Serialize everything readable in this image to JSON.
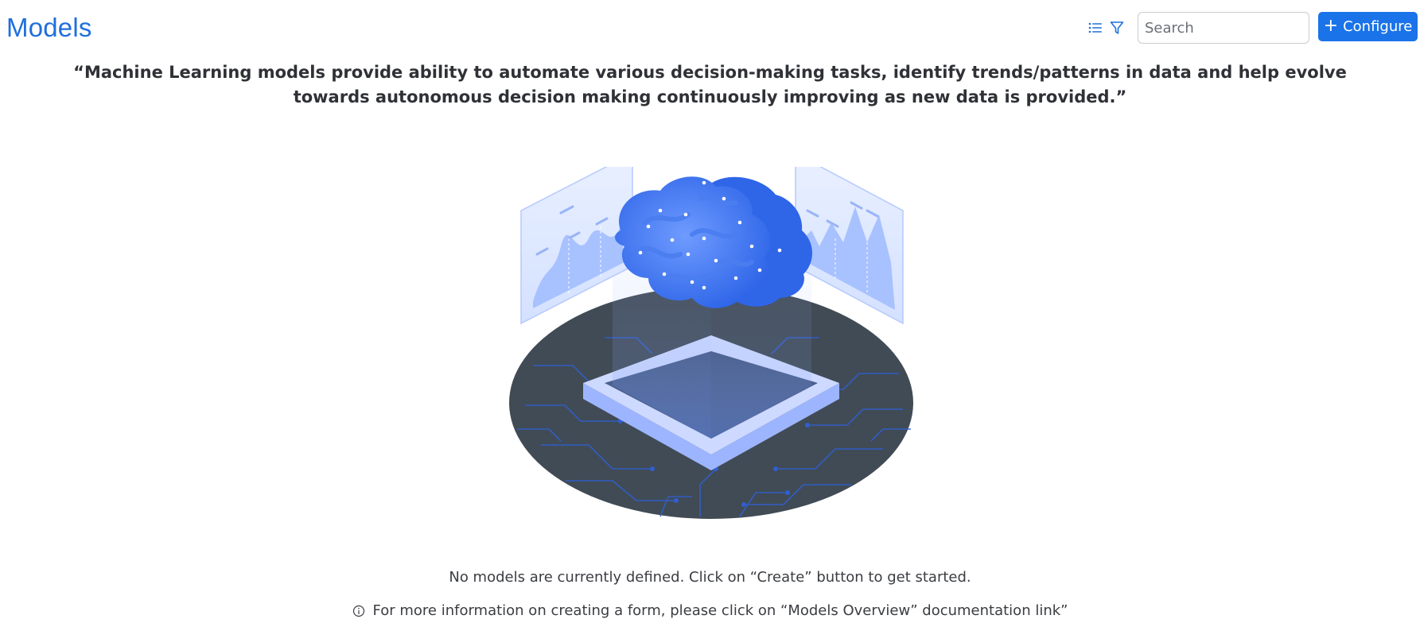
{
  "header": {
    "title": "Models",
    "list_icon": "list-icon",
    "filter_icon": "filter-icon",
    "search": {
      "placeholder": "Search",
      "value": ""
    },
    "configure_label": "Configure"
  },
  "quote": "“Machine Learning models provide ability to automate various decision-making tasks, identify trends/patterns in data and help evolve towards autonomous decision making continuously improving as new data is provided.”",
  "empty_state": {
    "illustration": "ml-brain-illustration",
    "message": "No models are currently defined. Click on “Create” button to get started.",
    "info_icon": "info-icon",
    "info": "For more information on creating a form, please click on “Models Overview” documentation link”"
  },
  "colors": {
    "accent": "#1a73e8",
    "title": "#1f6fdc",
    "platform": "#3f4b58"
  }
}
